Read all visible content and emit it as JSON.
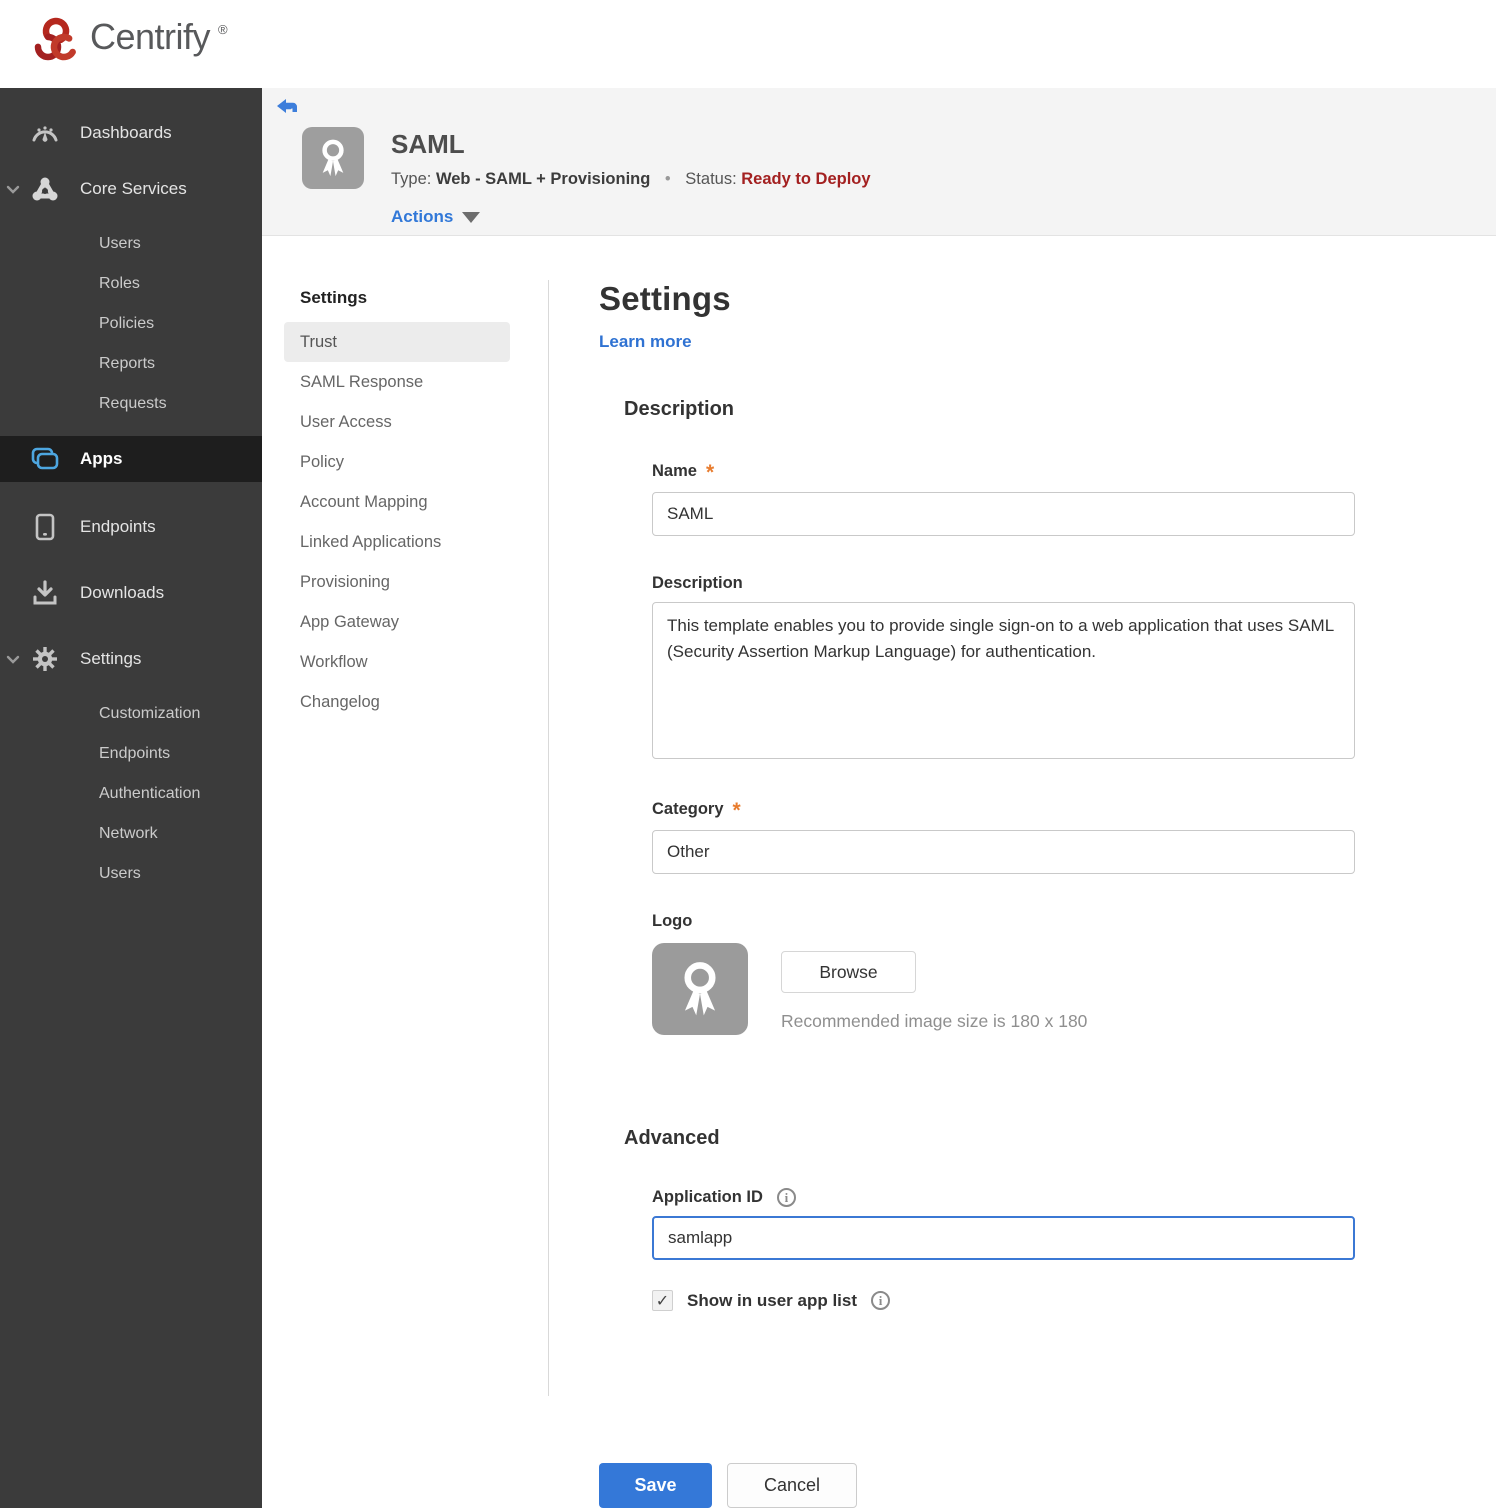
{
  "brand": {
    "name": "Centrify",
    "mark": "®"
  },
  "sidebar": {
    "items": [
      {
        "label": "Dashboards",
        "icon": "gauge-icon"
      },
      {
        "label": "Core Services",
        "icon": "core-services-icon",
        "expanded": true,
        "children": [
          "Users",
          "Roles",
          "Policies",
          "Reports",
          "Requests"
        ]
      },
      {
        "label": "Apps",
        "icon": "apps-icon",
        "active": true
      },
      {
        "label": "Endpoints",
        "icon": "device-icon"
      },
      {
        "label": "Downloads",
        "icon": "download-icon"
      },
      {
        "label": "Settings",
        "icon": "gear-icon",
        "expanded": true,
        "children": [
          "Customization",
          "Endpoints",
          "Authentication",
          "Network",
          "Users"
        ]
      }
    ]
  },
  "header": {
    "title": "SAML",
    "type_label": "Type:",
    "type_value": "Web - SAML + Provisioning",
    "separator": "•",
    "status_label": "Status:",
    "status_value": "Ready to Deploy",
    "actions_label": "Actions",
    "app_icon": "award-ribbon-icon",
    "status_color": "#a32020",
    "accent_color": "#3178d8"
  },
  "subnav": {
    "header": "Settings",
    "active_item": "Trust",
    "items": [
      "Trust",
      "SAML Response",
      "User Access",
      "Policy",
      "Account Mapping",
      "Linked Applications",
      "Provisioning",
      "App Gateway",
      "Workflow",
      "Changelog"
    ]
  },
  "main": {
    "title": "Settings",
    "learn_more_label": "Learn more",
    "required_marker": "*",
    "description_section": {
      "heading": "Description",
      "name_label": "Name",
      "name_value": "SAML",
      "description_label": "Description",
      "description_value": "This template enables you to provide single sign-on to a web application that uses SAML (Security Assertion Markup Language) for authentication.",
      "category_label": "Category",
      "category_value": "Other",
      "logo_label": "Logo",
      "logo_icon": "award-ribbon-icon",
      "browse_label": "Browse",
      "logo_hint": "Recommended image size is 180 x 180"
    },
    "advanced_section": {
      "heading": "Advanced",
      "application_id_label": "Application ID",
      "application_id_value": "samlapp",
      "show_in_user_app_list_label": "Show in user app list",
      "show_in_user_app_list_checked": true
    },
    "save_label": "Save",
    "cancel_label": "Cancel"
  }
}
